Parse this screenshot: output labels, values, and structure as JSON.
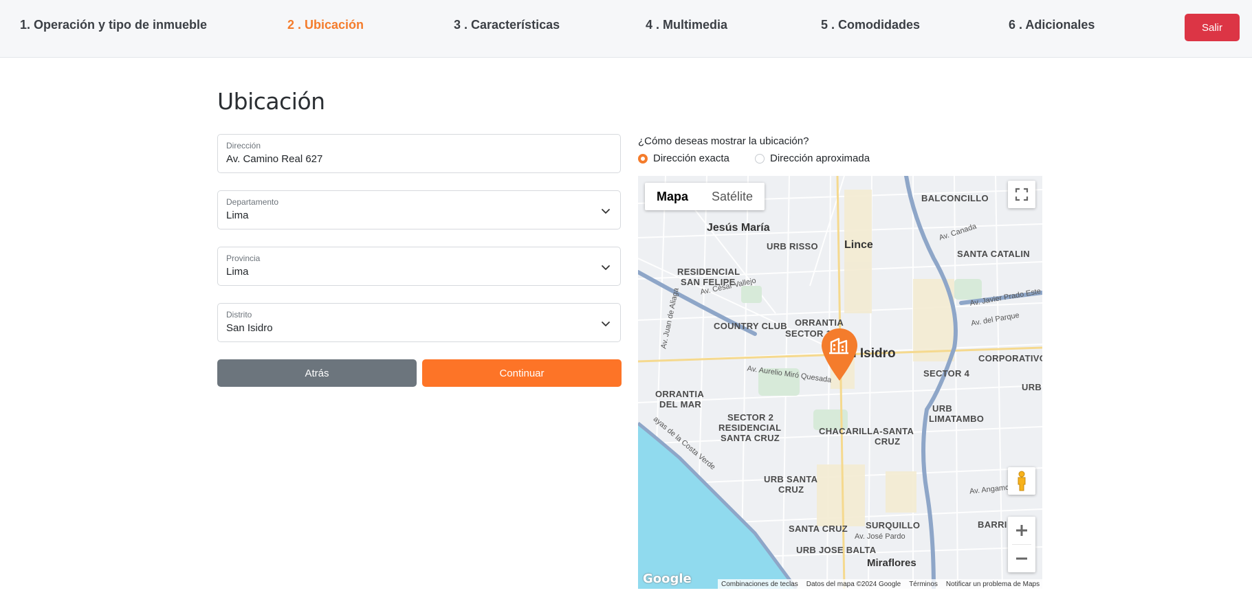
{
  "steps": [
    {
      "label": "1. Operación y tipo de inmueble"
    },
    {
      "label": "2 . Ubicación"
    },
    {
      "label": "3 . Características"
    },
    {
      "label": "4 . Multimedia"
    },
    {
      "label": "5 . Comodidades"
    },
    {
      "label": "6 . Adicionales"
    }
  ],
  "exit_label": "Salir",
  "page_title": "Ubicación",
  "form": {
    "address": {
      "label": "Dirección",
      "value": "Av. Camino Real 627"
    },
    "department": {
      "label": "Departamento",
      "value": "Lima"
    },
    "province": {
      "label": "Provincia",
      "value": "Lima"
    },
    "district": {
      "label": "Distrito",
      "value": "San Isidro"
    },
    "back_label": "Atrás",
    "continue_label": "Continuar"
  },
  "location": {
    "question": "¿Cómo deseas mostrar la ubicación?",
    "options": [
      {
        "label": "Dirección exacta",
        "checked": true
      },
      {
        "label": "Dirección aproximada",
        "checked": false
      }
    ]
  },
  "map": {
    "type_map": "Mapa",
    "type_satellite": "Satélite",
    "google": "Google",
    "labels": {
      "balconcillo": "BALCONCILLO",
      "jesus_maria": "Jesús María",
      "urb_risso": "URB RISSO",
      "lince": "Lince",
      "santa_catalina": "SANTA CATALIN",
      "residencial_sf_1": "RESIDENCIAL",
      "residencial_sf_2": "SAN FELIPE",
      "country_club": "COUNTRY CLUB",
      "orrantia": "ORRANTIA",
      "sector_1": "SECTOR 1",
      "san_isidro": "n Isidro",
      "sector_4": "SECTOR 4",
      "corporativo": "CORPORATIVO",
      "orrantia_mar_1": "ORRANTIA",
      "orrantia_mar_2": "DEL MAR",
      "urb": "URB",
      "limatambo_1": "URB",
      "limatambo_2": "LIMATAMBO",
      "sector2_1": "SECTOR 2",
      "sector2_2": "RESIDENCIAL",
      "sector2_3": "SANTA CRUZ",
      "chacarilla_1": "CHACARILLA-SANTA",
      "chacarilla_2": "CRUZ",
      "urb_santa_cruz_1": "URB SANTA",
      "urb_santa_cruz_2": "CRUZ",
      "santa_cruz": "SANTA CRUZ",
      "surquillo": "SURQUILLO",
      "barrio": "BARRI",
      "urb_jose_balta": "URB JOSE BALTA",
      "miraflores": "Miraflores",
      "road_canada": "Av. Canada",
      "road_cesar_vallejo": "Av. César Vallejo",
      "road_javier_prado": "Av. Javier Prado Este",
      "road_del_parque": "Av. del Parque",
      "road_aurelio": "Av. Aurelio Miró Quesada",
      "road_angamos": "Av. Angamos Este",
      "road_jose_pardo": "Av. José Pardo",
      "road_juan_aliaga": "Av. Juan de Aliaga",
      "road_costa_verde": "ayas de la Costa Verde"
    },
    "attribution": {
      "shortcuts": "Combinaciones de teclas",
      "data": "Datos del mapa ©2024 Google",
      "terms": "Términos",
      "report": "Notificar un problema de Maps"
    },
    "colors": {
      "accent": "#f47c2c",
      "water": "#90daee",
      "highway": "#8ea6c8"
    }
  }
}
